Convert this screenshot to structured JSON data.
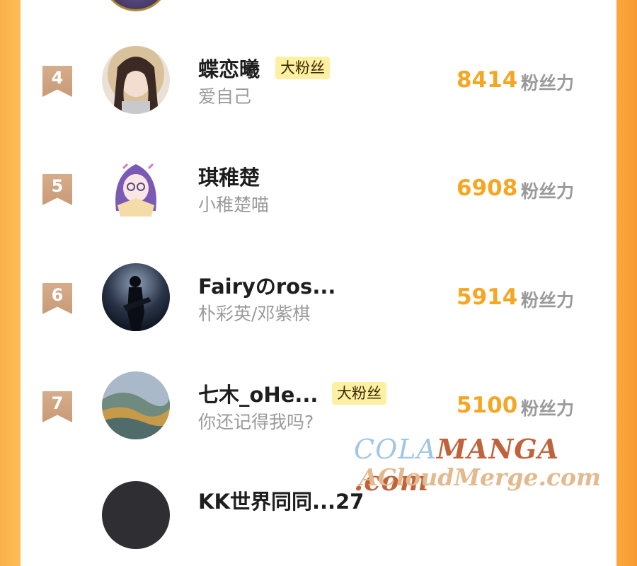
{
  "leaderboard": {
    "unit_label": "粉丝力",
    "badge_label": "大粉丝",
    "entries": [
      {
        "rank": "4",
        "name": "蝶恋曦",
        "subtitle": "爱自己",
        "score": "8414",
        "has_badge": true,
        "avatar": "avatar-girl-photo"
      },
      {
        "rank": "5",
        "name": "琪稚楚",
        "subtitle": "小稚楚喵",
        "score": "6908",
        "has_badge": false,
        "avatar": "avatar-anime-girl"
      },
      {
        "rank": "6",
        "name": "Fairyのros...",
        "subtitle": "朴彩英/邓紫棋",
        "score": "5914",
        "has_badge": false,
        "avatar": "avatar-guitar-silhouette"
      },
      {
        "rank": "7",
        "name": "七木_oHe...",
        "subtitle": "你还记得我吗?",
        "score": "5100",
        "has_badge": true,
        "avatar": "avatar-ocean-wave"
      },
      {
        "rank": "",
        "name": "KK世界同同...27",
        "subtitle": "",
        "score": "",
        "has_badge": false,
        "avatar": "avatar-dark"
      }
    ]
  },
  "watermark": {
    "line1_a": "COLA",
    "line1_b": "MANGA",
    "line1_c": " .com",
    "line2": "ACloudMerge.com"
  },
  "colors": {
    "accent_score": "#f5a623",
    "badge_bg": "#fdf0a3",
    "rank_ribbon": "#d2a684",
    "side_orange": "#fbb14a"
  }
}
